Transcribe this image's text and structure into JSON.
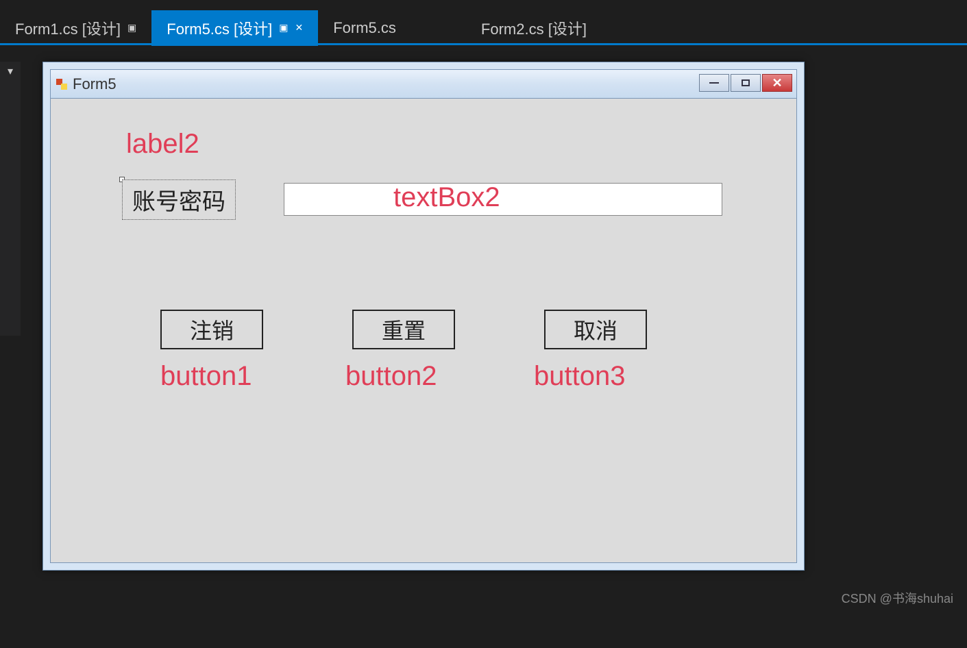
{
  "tabs": [
    {
      "label": "Form1.cs [设计]",
      "active": false,
      "pinned": true,
      "closeable": false
    },
    {
      "label": "Form5.cs [设计]",
      "active": true,
      "pinned": true,
      "closeable": true
    },
    {
      "label": "Form5.cs",
      "active": false,
      "pinned": false,
      "closeable": false
    },
    {
      "label": "Form2.cs [设计]",
      "active": false,
      "pinned": false,
      "closeable": false
    }
  ],
  "form": {
    "title": "Form5",
    "label2_name": "label2",
    "label2_text": "账号密码",
    "textbox2_name": "textBox2",
    "textbox2_value": "",
    "button1_name": "button1",
    "button1_text": "注销",
    "button2_name": "button2",
    "button2_text": "重置",
    "button3_name": "button3",
    "button3_text": "取消"
  },
  "watermark": "CSDN @书海shuhai"
}
